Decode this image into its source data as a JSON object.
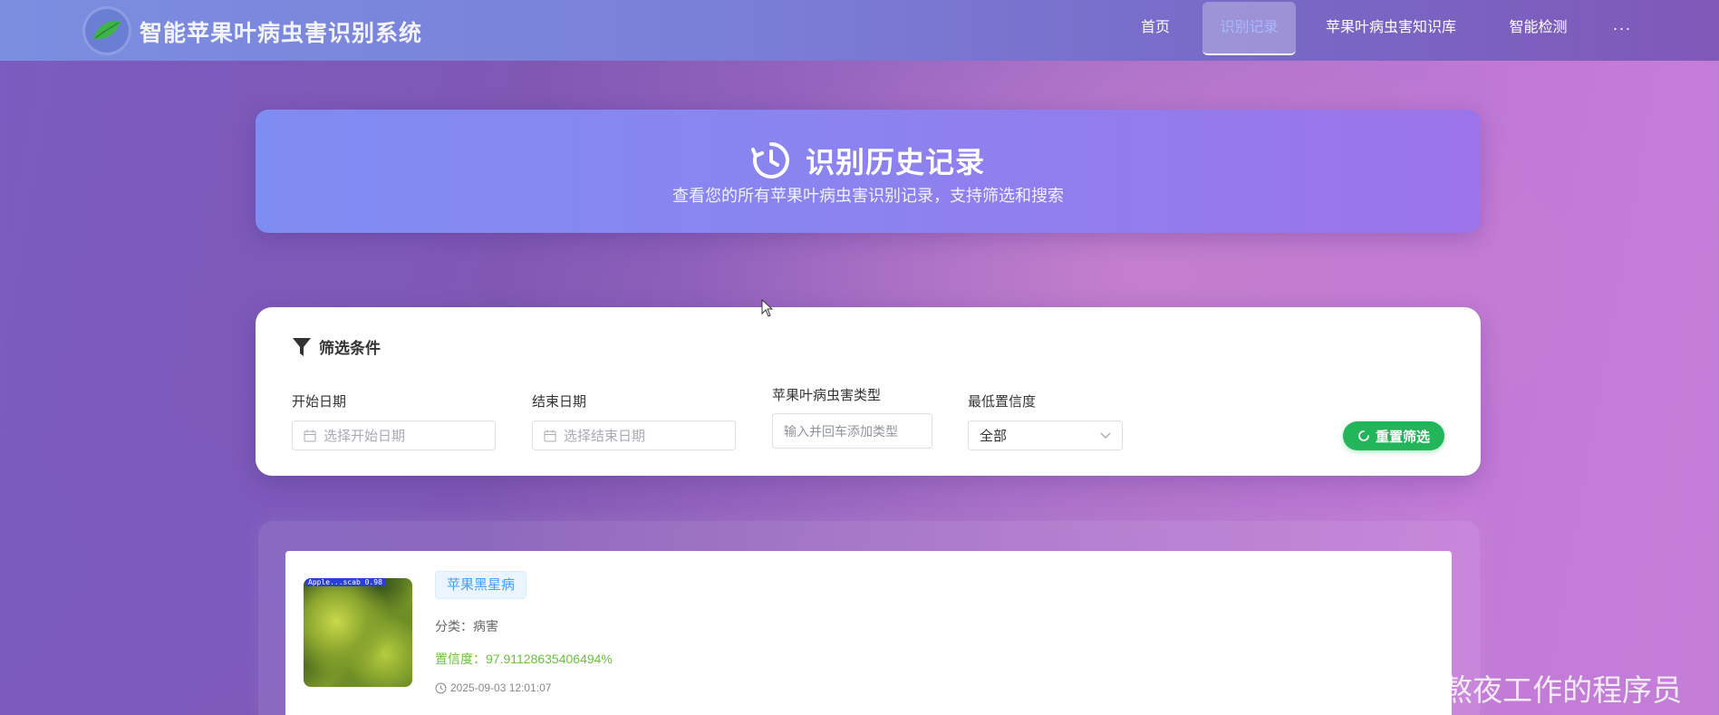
{
  "app": {
    "title": "智能苹果叶病虫害识别系统",
    "logo_icon": "leaf-icon"
  },
  "nav": {
    "items": [
      {
        "label": "首页",
        "active": false
      },
      {
        "label": "识别记录",
        "active": true
      },
      {
        "label": "苹果叶病虫害知识库",
        "active": false
      },
      {
        "label": "智能检测",
        "active": false
      }
    ],
    "more": "···"
  },
  "header": {
    "icon": "history-clock-icon",
    "title": "识别历史记录",
    "subtitle": "查看您的所有苹果叶病虫害识别记录，支持筛选和搜索"
  },
  "filters": {
    "title": "筛选条件",
    "icon": "filter-icon",
    "start_date": {
      "label": "开始日期",
      "placeholder": "选择开始日期"
    },
    "end_date": {
      "label": "结束日期",
      "placeholder": "选择结束日期"
    },
    "type": {
      "label": "苹果叶病虫害类型",
      "placeholder": "输入并回车添加类型"
    },
    "min_confidence": {
      "label": "最低置信度",
      "value": "全部"
    },
    "reset_label": "重置筛选"
  },
  "records": [
    {
      "image_label": "Apple...scab 0.98",
      "disease": "苹果黑星病",
      "category": "分类：病害",
      "confidence": "置信度：97.911286354064 94%",
      "confidence_text": "置信度：97.91128635406494%",
      "time": "2025-09-03 12:01:07"
    }
  ],
  "watermark": "CSDN @爱上熬夜工作的程序员",
  "colors": {
    "accent_green": "#22b55a",
    "tag_blue": "#409eff",
    "confidence_green": "#67c23a"
  }
}
